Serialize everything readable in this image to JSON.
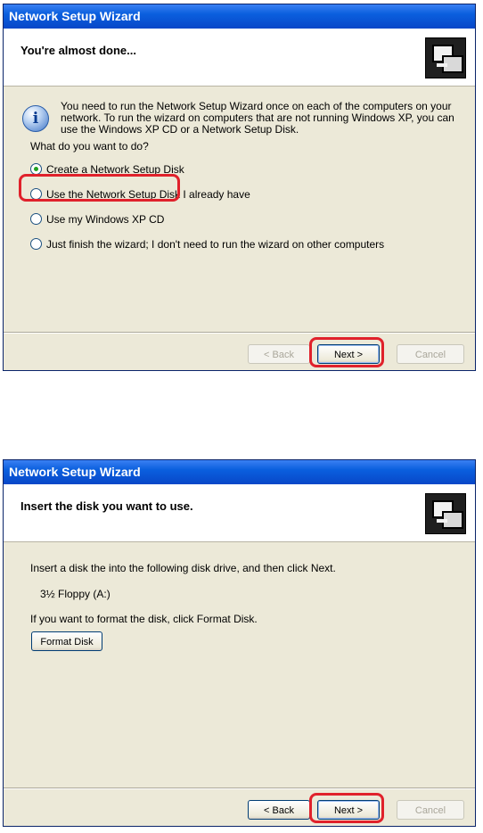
{
  "dialog1": {
    "title": "Network Setup Wizard",
    "header_title": "You're almost done...",
    "info_text": "You need to run the Network Setup Wizard once on each of the computers on your network. To run the wizard on computers that are not running Windows XP, you can use the Windows XP CD or a Network Setup Disk.",
    "question": "What do you want to do?",
    "options": [
      {
        "label": "Create a Network Setup Disk",
        "selected": true
      },
      {
        "label": "Use the Network Setup Disk I already have",
        "selected": false
      },
      {
        "label": "Use my Windows XP CD",
        "selected": false
      },
      {
        "label": "Just finish the wizard; I don't need to run the wizard on other computers",
        "selected": false
      }
    ],
    "buttons": {
      "back": "< Back",
      "next": "Next >",
      "cancel": "Cancel"
    }
  },
  "dialog2": {
    "title": "Network Setup Wizard",
    "header_title": "Insert the disk you want to use.",
    "instruction": "Insert a disk the into the following disk drive, and then click Next.",
    "drive": "3½ Floppy (A:)",
    "format_text": "If you want to format the disk, click Format Disk.",
    "format_button": "Format Disk",
    "buttons": {
      "back": "< Back",
      "next": "Next >",
      "cancel": "Cancel"
    }
  },
  "colors": {
    "highlight": "#e0212b",
    "titlebar": "#0a5fde",
    "dialog_bg": "#ece9d8"
  }
}
